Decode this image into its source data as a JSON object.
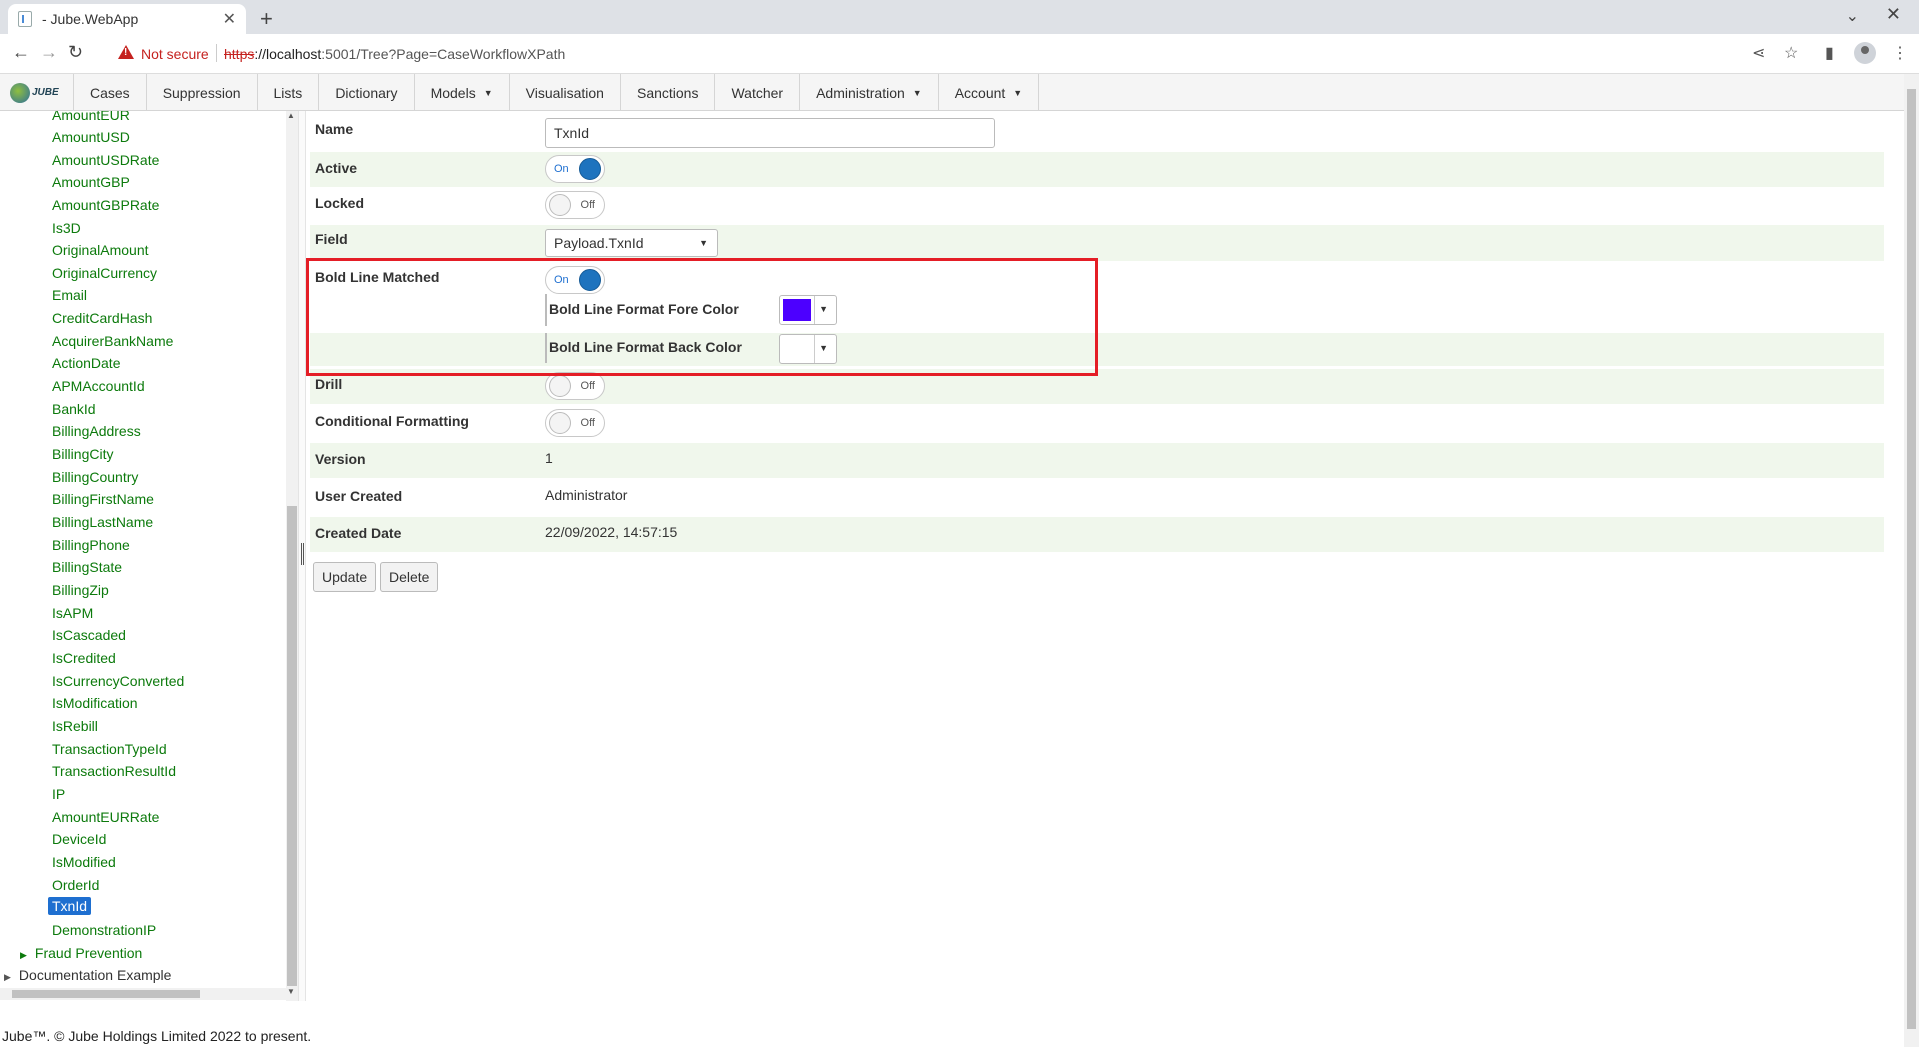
{
  "browser": {
    "tab_title": "- Jube.WebApp",
    "not_secure": "Not secure",
    "url_https": "https",
    "url_host": "://localhost",
    "url_rest": ":5001/Tree?Page=CaseWorkflowXPath"
  },
  "menu": {
    "logo_text": "JUBE",
    "items": [
      "Cases",
      "Suppression",
      "Lists",
      "Dictionary",
      "Models",
      "Visualisation",
      "Sanctions",
      "Watcher",
      "Administration",
      "Account"
    ]
  },
  "tree": {
    "items": [
      "AmountEUR",
      "AmountUSD",
      "AmountUSDRate",
      "AmountGBP",
      "AmountGBPRate",
      "Is3D",
      "OriginalAmount",
      "OriginalCurrency",
      "Email",
      "CreditCardHash",
      "AcquirerBankName",
      "ActionDate",
      "APMAccountId",
      "BankId",
      "BillingAddress",
      "BillingCity",
      "BillingCountry",
      "BillingFirstName",
      "BillingLastName",
      "BillingPhone",
      "BillingState",
      "BillingZip",
      "IsAPM",
      "IsCascaded",
      "IsCredited",
      "IsCurrencyConverted",
      "IsModification",
      "IsRebill",
      "TransactionTypeId",
      "TransactionResultId",
      "IP",
      "AmountEURRate",
      "DeviceId",
      "IsModified",
      "OrderId",
      "TxnId",
      "DemonstrationIP"
    ],
    "selected": "TxnId",
    "fraud_prevention": "Fraud Prevention",
    "documentation_example": "Documentation Example"
  },
  "form": {
    "name_label": "Name",
    "name_value": "TxnId",
    "active_label": "Active",
    "active_state": "On",
    "locked_label": "Locked",
    "locked_state": "Off",
    "field_label": "Field",
    "field_value": "Payload.TxnId",
    "bold_label": "Bold Line Matched",
    "bold_state": "On",
    "fore_label": "Bold Line Format Fore Color",
    "fore_color": "#4c00ff",
    "back_label": "Bold Line Format Back Color",
    "back_color": "#ffffff",
    "drill_label": "Drill",
    "drill_state": "Off",
    "cond_label": "Conditional Formatting",
    "cond_state": "Off",
    "version_label": "Version",
    "version_value": "1",
    "user_label": "User Created",
    "user_value": "Administrator",
    "date_label": "Created Date",
    "date_value": "22/09/2022, 14:57:15",
    "update_button": "Update",
    "delete_button": "Delete"
  },
  "footer": "Jube™. © Jube Holdings Limited 2022 to present."
}
